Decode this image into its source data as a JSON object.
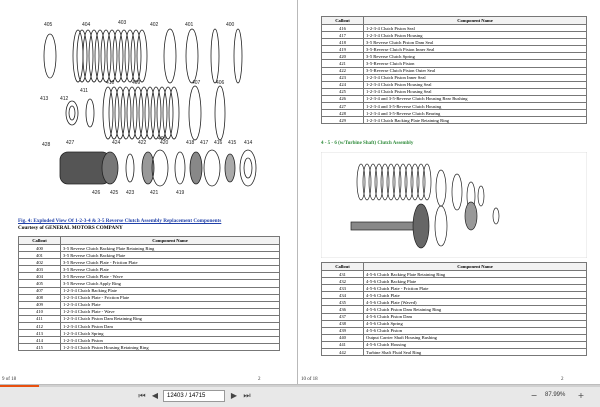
{
  "left_page": {
    "diagram_callouts_top": [
      "405",
      "404",
      "403",
      "402",
      "401",
      "400"
    ],
    "diagram_callouts_mid": [
      "413",
      "412",
      "411",
      "410",
      "409",
      "408",
      "407",
      "406"
    ],
    "diagram_callouts_bottom": [
      "428",
      "427",
      "426",
      "425",
      "424",
      "423",
      "422",
      "421",
      "420",
      "419",
      "418",
      "417",
      "416",
      "415",
      "414"
    ],
    "figure_caption": "Fig. 4: Exploded View Of 1-2-3-4 & 3-5 Reverse Clutch Assembly Replacement Components",
    "courtesy": "Courtesy of GENERAL MOTORS COMPANY",
    "table_headers": [
      "Callout",
      "Component Name"
    ],
    "rows": [
      {
        "callout": "400",
        "name": "3-5 Reverse Clutch Backing Plate Retaining Ring"
      },
      {
        "callout": "401",
        "name": "3-5 Reverse Clutch Backing Plate"
      },
      {
        "callout": "402",
        "name": "3-5 Reverse Clutch Plate - Friction Plate"
      },
      {
        "callout": "403",
        "name": "3-5 Reverse Clutch Plate"
      },
      {
        "callout": "404",
        "name": "3-5 Reverse Clutch Plate - Wave"
      },
      {
        "callout": "405",
        "name": "3-5 Reverse Clutch Apply Ring"
      },
      {
        "callout": "407",
        "name": "1-2-3-4 Clutch Backing Plate"
      },
      {
        "callout": "408",
        "name": "1-2-3-4 Clutch Plate - Friction Plate"
      },
      {
        "callout": "409",
        "name": "1-2-3-4 Clutch Plate"
      },
      {
        "callout": "410",
        "name": "1-2-3-4 Clutch Plate - Wave"
      },
      {
        "callout": "411",
        "name": "1-2-3-4 Clutch Piston Dam Retaining Ring"
      },
      {
        "callout": "412",
        "name": "1-2-3-4 Clutch Piston Dam"
      },
      {
        "callout": "413",
        "name": "1-2-3-4 Clutch Spring"
      },
      {
        "callout": "414",
        "name": "1-2-3-4 Clutch Piston"
      },
      {
        "callout": "415",
        "name": "1-2-3-4 Clutch Piston Housing Retaining Ring"
      }
    ],
    "footer_page": "9 of 18",
    "footer_num": "2"
  },
  "right_page": {
    "table_headers": [
      "Callout",
      "Component Name"
    ],
    "rows": [
      {
        "callout": "416",
        "name": "1-2-3-4 Clutch Piston Seal"
      },
      {
        "callout": "417",
        "name": "1-2-3-4 Clutch Piston Housing"
      },
      {
        "callout": "418",
        "name": "3-5 Reverse Clutch Piston Dam Seal"
      },
      {
        "callout": "419",
        "name": "3-5-Reverse Clutch Piston Inner Seal"
      },
      {
        "callout": "420",
        "name": "3-5 Reverse Clutch Spring"
      },
      {
        "callout": "421",
        "name": "3-5-Reverse Clutch Piston"
      },
      {
        "callout": "422",
        "name": "3-5-Reverse Clutch Piston Outer Seal"
      },
      {
        "callout": "423",
        "name": "1-2-3-4 Clutch Piston Inner Seal"
      },
      {
        "callout": "424",
        "name": "1-2-3-4 Clutch Piston Housing Seal"
      },
      {
        "callout": "425",
        "name": "1-2-3-4 Clutch Piston Housing Seal"
      },
      {
        "callout": "426",
        "name": "1-2-3-4 and 3-5-Reverse Clutch Housing Rear Bushing"
      },
      {
        "callout": "427",
        "name": "1-2-3-4 and 3-5-Reverse Clutch Housing"
      },
      {
        "callout": "428",
        "name": "1-2-3-4 and 3-5-Reverse Clutch Bearing"
      },
      {
        "callout": "429",
        "name": "1-2-3-4 Clutch Backing Plate Retaining Ring"
      }
    ],
    "section_heading": "4 - 5 - 6 (w/Turbine Shaft) Clutch Assembly",
    "table2_headers": [
      "Callout",
      "Component Name"
    ],
    "rows2": [
      {
        "callout": "431",
        "name": "4-5-6 Clutch Backing Plate Retaining Ring"
      },
      {
        "callout": "432",
        "name": "4-5-6 Clutch Backing Plate"
      },
      {
        "callout": "433",
        "name": "4-5-6 Clutch Plate - Friction Plate"
      },
      {
        "callout": "434",
        "name": "4-5-6 Clutch Plate"
      },
      {
        "callout": "435",
        "name": "4-5-6 Clutch Plate (Waved)"
      },
      {
        "callout": "436",
        "name": "4-5-6 Clutch Piston Dam Retaining Ring"
      },
      {
        "callout": "437",
        "name": "4-5-6 Clutch Piston Dam"
      },
      {
        "callout": "438",
        "name": "4-5-6 Clutch Spring"
      },
      {
        "callout": "439",
        "name": "4-5-6 Clutch Piston"
      },
      {
        "callout": "440",
        "name": "Output Carrier Shaft Housing Bushing"
      },
      {
        "callout": "441",
        "name": "4-5-6 Clutch Housing"
      },
      {
        "callout": "442",
        "name": "Turbine Shaft Fluid Seal Ring"
      }
    ],
    "footer_page": "10 of 18",
    "footer_num": "2"
  },
  "toolbar": {
    "first_icon": "first-page-icon",
    "prev_icon": "prev-page-icon",
    "page_value": "12403 / 14715",
    "next_icon": "next-page-icon",
    "last_icon": "last-page-icon",
    "zoom_out_icon": "zoom-out-icon",
    "zoom_value": "87.99%",
    "zoom_in_icon": "zoom-in-icon",
    "accent": "#e8500f",
    "progress_fraction": 0.065
  }
}
